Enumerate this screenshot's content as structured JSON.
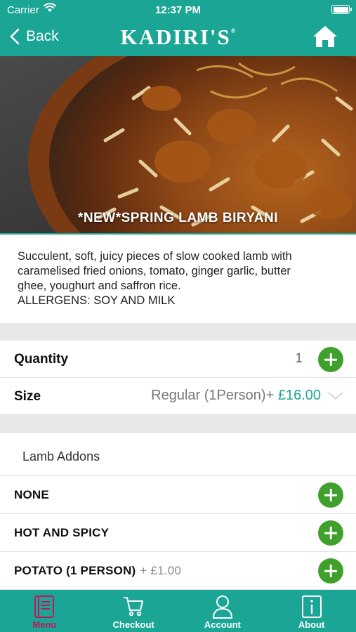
{
  "status_bar": {
    "carrier": "Carrier",
    "time": "12:37 PM"
  },
  "header": {
    "back_label": "Back",
    "brand": "KADIRI'S",
    "brand_mark": "®"
  },
  "product": {
    "title": "*NEW*SPRING LAMB BIRYANI",
    "description_lines": [
      "Succulent, soft, juicy pieces of slow cooked lamb with",
      "caramelised fried onions, tomato, ginger garlic, butter",
      "ghee, youghurt and saffron rice.",
      "ALLERGENS: SOY AND MILK"
    ]
  },
  "options": {
    "quantity_label": "Quantity",
    "quantity_value": "1",
    "size_label": "Size",
    "size_value": "Regular (1Person)+",
    "size_price": "£16.00"
  },
  "addons": {
    "section_title": "Lamb Addons",
    "items": [
      {
        "label": "NONE",
        "price": ""
      },
      {
        "label": "HOT AND SPICY",
        "price": ""
      },
      {
        "label": "POTATO (1 PERSON)",
        "price": "+ £1.00"
      }
    ]
  },
  "tabs": [
    {
      "label": "Menu",
      "icon": "menu-book-icon",
      "active": true
    },
    {
      "label": "Checkout",
      "icon": "cart-icon",
      "active": false
    },
    {
      "label": "Account",
      "icon": "person-icon",
      "active": false
    },
    {
      "label": "About",
      "icon": "info-icon",
      "active": false
    }
  ],
  "colors": {
    "brand": "#1aa594",
    "add_button": "#3fa12c",
    "active_tab": "#c2185b"
  }
}
